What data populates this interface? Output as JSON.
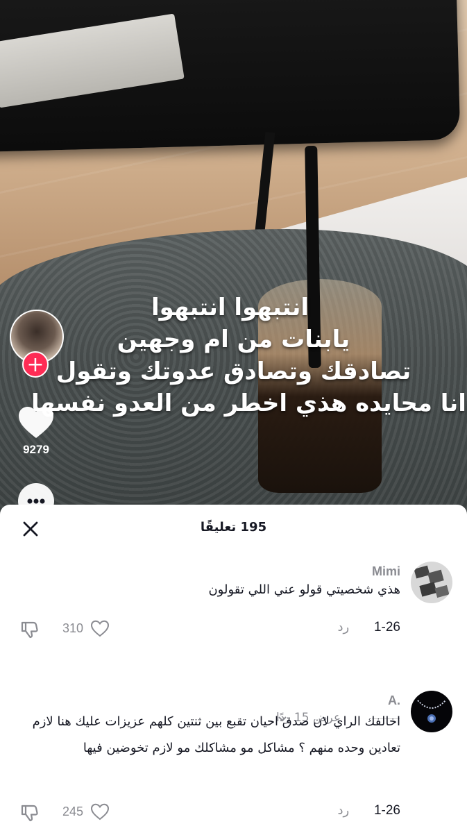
{
  "video": {
    "overlay_lines": [
      "انتبهوا انتبهوا",
      "يابنات من ام وجهين",
      "تصادقك وتصادق عدوتك وتقول",
      "انا محايده هذي اخطر من العدو نفسها"
    ],
    "like_count": "9279",
    "follow_label": "+"
  },
  "comments_sheet": {
    "title": "195 تعليقًا",
    "comments": [
      {
        "username": "Mimi",
        "text": "هذي شخصيتي قولو عني اللي تقولون",
        "date": "1-26",
        "reply_label": "رد",
        "likes": "310",
        "view_replies": "عرض 15 ردًا"
      },
      {
        "username": "A.",
        "text": "اخالفك الراي لان صدق احيان تقبع بين ثنتين كلهم عزيزات عليك هنا لازم تعادين وحده منهم ؟ مشاكل مو مشاكلك مو لازم تخوضين فيها",
        "date": "1-26",
        "reply_label": "رد",
        "likes": "245"
      }
    ]
  },
  "colors": {
    "accent": "#fe2c55",
    "text_primary": "#161823",
    "text_secondary": "#8a8b91"
  },
  "icons": [
    "close-icon",
    "heart-icon",
    "dislike-icon",
    "more-icon",
    "plus-icon",
    "chevron-down-icon"
  ]
}
